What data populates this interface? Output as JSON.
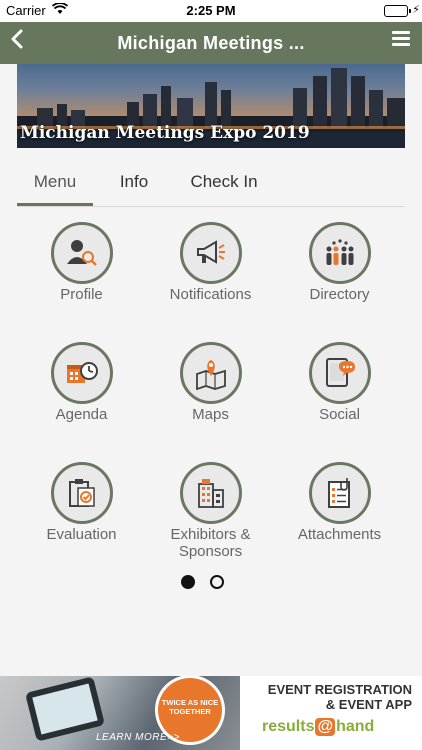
{
  "status_bar": {
    "carrier": "Carrier",
    "time": "2:25 PM",
    "battery_level": 1.0
  },
  "nav": {
    "title": "Michigan Meetings ...",
    "back_icon": "chevron-left-icon",
    "menu_icon": "hamburger-icon"
  },
  "banner": {
    "title": "Michigan Meetings Expo 2019"
  },
  "tabs": [
    {
      "label": "Menu",
      "active": true
    },
    {
      "label": "Info",
      "active": false
    },
    {
      "label": "Check In",
      "active": false
    }
  ],
  "menu_items": [
    {
      "label": "Profile",
      "icon": "profile-icon"
    },
    {
      "label": "Notifications",
      "icon": "megaphone-icon"
    },
    {
      "label": "Directory",
      "icon": "people-icon"
    },
    {
      "label": "Agenda",
      "icon": "calendar-clock-icon"
    },
    {
      "label": "Maps",
      "icon": "map-pin-icon"
    },
    {
      "label": "Social",
      "icon": "chat-icon"
    },
    {
      "label": "Evaluation",
      "icon": "clipboard-check-icon"
    },
    {
      "label": "Exhibitors & Sponsors",
      "icon": "building-icon"
    },
    {
      "label": "Attachments",
      "icon": "paperclip-document-icon"
    }
  ],
  "pager": {
    "current_page": 1,
    "page_count": 2
  },
  "ad": {
    "badge": "TWICE AS NICE TOGETHER",
    "learn_more": "LEARN MORE>>",
    "headline_line1": "EVENT REGISTRATION",
    "headline_line2": "& EVENT APP",
    "brand_part1": "results",
    "brand_at": "@",
    "brand_part2": "hand"
  },
  "colors": {
    "nav_bar": "#66775d",
    "icon_ring": "#6b7763",
    "icon_accent": "#e8762b",
    "background": "#f4f4f4"
  }
}
